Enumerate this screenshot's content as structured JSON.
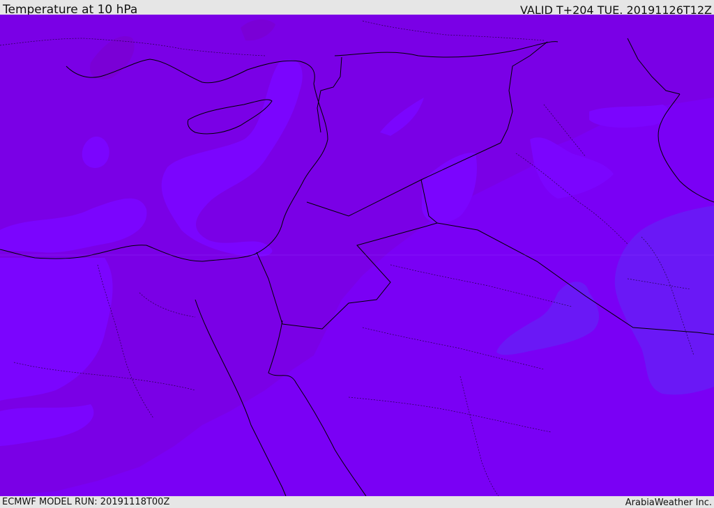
{
  "header": {
    "title": "Temperature at 10 hPa",
    "valid_time": "VALID T+204 TUE. 20191126T12Z"
  },
  "footer": {
    "model_run": "ECMWF MODEL RUN: 20191118T00Z",
    "credit": "ArabiaWeather Inc."
  },
  "colors": {
    "field_warm": "#7a00e6",
    "field_mid": "#7a00f5",
    "field_cool": "#7b05fe",
    "field_coldest": "#6a18f6",
    "border_line": "#000000",
    "frame_background": "#e6e6e6"
  }
}
